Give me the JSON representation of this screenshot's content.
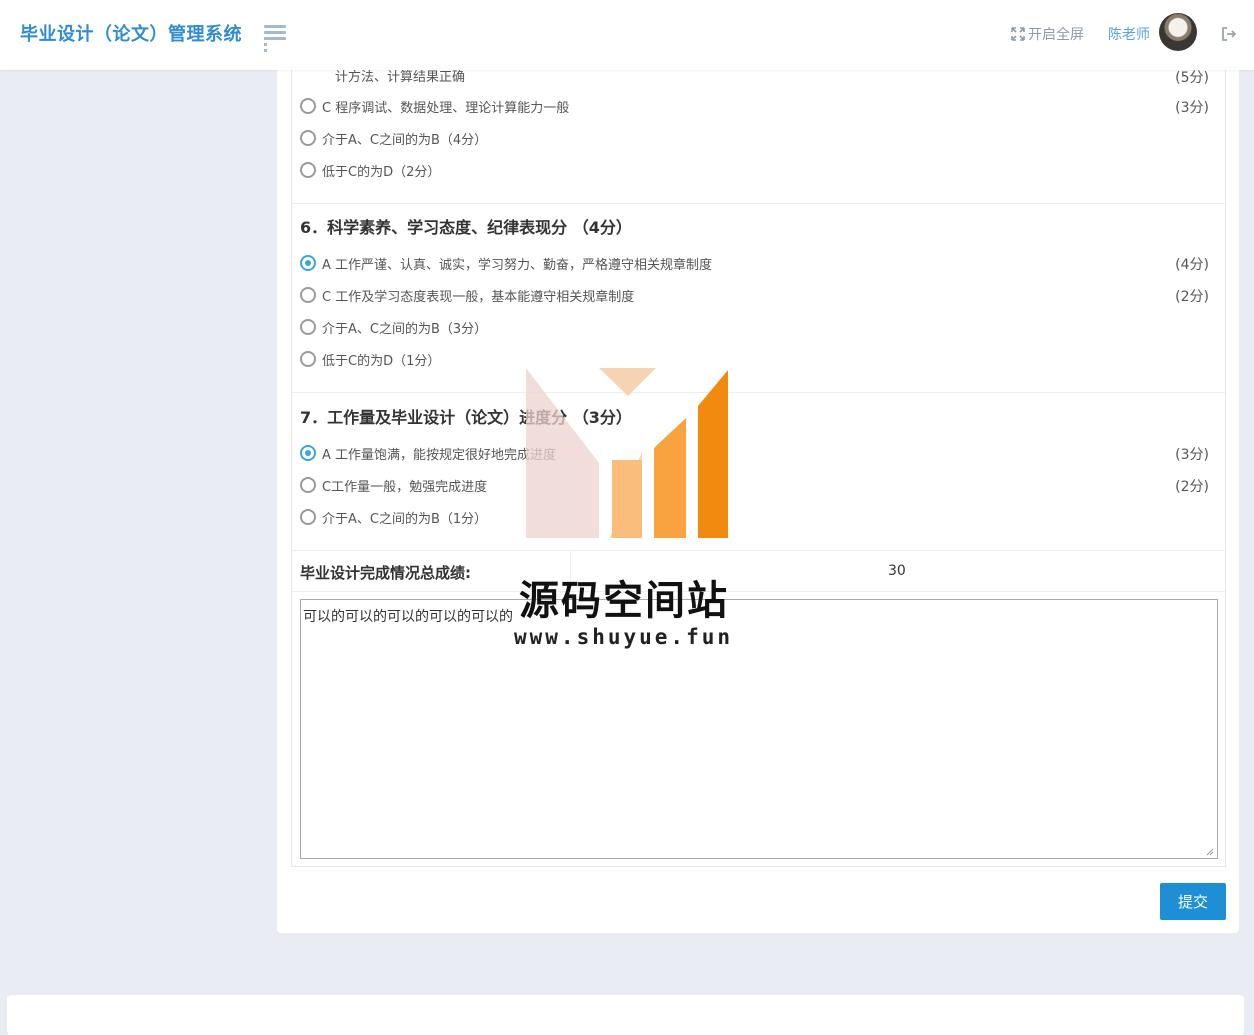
{
  "header": {
    "title": "毕业设计（论文）管理系统",
    "fullscreen_label": "开启全屏",
    "user_name": "陈老师"
  },
  "form": {
    "partial_item": {
      "text": "计方法、计算结果正确",
      "score": "(5分)"
    },
    "q5_options": [
      {
        "label": "C 程序调试、数据处理、理论计算能力一般",
        "score": "(3分)",
        "checked": false
      },
      {
        "label": "介于A、C之间的为B（4分）",
        "score": "",
        "checked": false
      },
      {
        "label": "低于C的为D（2分）",
        "score": "",
        "checked": false
      }
    ],
    "q6": {
      "title": "6．科学素养、学习态度、纪律表现分 （4分）",
      "options": [
        {
          "label": "A 工作严谨、认真、诚实，学习努力、勤奋，严格遵守相关规章制度",
          "score": "(4分)",
          "checked": true
        },
        {
          "label": "C 工作及学习态度表现一般，基本能遵守相关规章制度",
          "score": "(2分)",
          "checked": false
        },
        {
          "label": "介于A、C之间的为B（3分）",
          "score": "",
          "checked": false
        },
        {
          "label": "低于C的为D（1分）",
          "score": "",
          "checked": false
        }
      ]
    },
    "q7": {
      "title": "7．工作量及毕业设计（论文）进度分 （3分）",
      "options": [
        {
          "label": "A 工作量饱满，能按规定很好地完成进度",
          "score": "(3分)",
          "checked": true
        },
        {
          "label": "C工作量一般，勉强完成进度",
          "score": "(2分)",
          "checked": false
        },
        {
          "label": "介于A、C之间的为B（1分）",
          "score": "",
          "checked": false
        }
      ]
    },
    "total_label": "毕业设计完成情况总成绩:",
    "total_value": "30",
    "comment_value": "可以的可以的可以的可以的可以的",
    "submit_label": "提交"
  },
  "watermark": {
    "title": "源码空间站",
    "url": "www.shuyue.fun"
  },
  "colors": {
    "brand": "#2e8cd2",
    "accent": "#1e8fd5",
    "radio_checked": "#3aa5dd",
    "page_bg": "#e9ecf2"
  }
}
